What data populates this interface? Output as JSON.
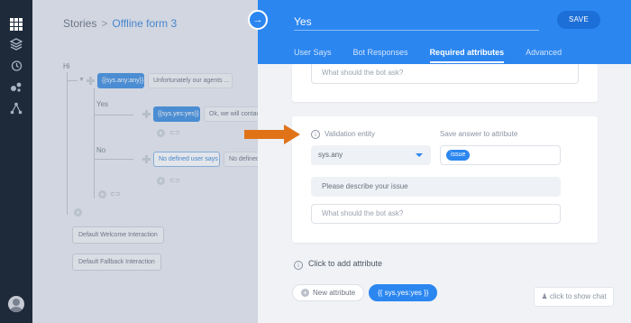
{
  "breadcrumb": {
    "root": "Stories",
    "separator": ">",
    "current": "Offline form 3"
  },
  "canvas": {
    "root_label": "Hi",
    "branch_yes": "Yes",
    "branch_no": "No",
    "chip_any": "{{sys.any:any}}",
    "chip_any_reply": "Unfortunately our agents ...",
    "chip_yes": "{{sys.yes:yes}}",
    "chip_yes_reply": "Ok, we will contac",
    "chip_no": "No defined user says",
    "chip_no_reply": "No defined",
    "default_welcome": "Default Welcome Interaction",
    "default_fallback": "Default Fallback Interaction"
  },
  "panel": {
    "title_value": "Yes",
    "save_label": "SAVE",
    "tabs": [
      {
        "label": "User Says"
      },
      {
        "label": "Bot Responses"
      },
      {
        "label": "Required attributes"
      },
      {
        "label": "Advanced"
      }
    ],
    "first_card": {
      "question_placeholder": "What should the bot ask?"
    },
    "second_card": {
      "validation_label": "Validation entity",
      "validation_value": "sys.any",
      "save_label": "Save answer to attribute",
      "attribute_chip": "issue",
      "prompt_value": "Please describe your issue",
      "question_placeholder": "What should the bot ask?"
    },
    "add_attribute": "Click to add attribute",
    "new_attribute": "New attribute",
    "sys_chip": "{{ sys.yes:yes }}",
    "show_chat": "click to show chat"
  },
  "colors": {
    "accent": "#2b86f0",
    "rail": "#1e2a3a",
    "arrow": "#e07318"
  }
}
